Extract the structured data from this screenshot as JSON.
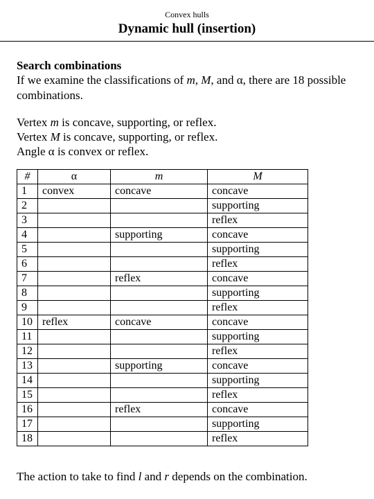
{
  "header": {
    "topic": "Convex hulls",
    "title": "Dynamic hull (insertion)"
  },
  "section": {
    "heading": "Search combinations",
    "p1a": "If we examine the classifications of ",
    "p1_m": "m",
    "p1_comma1": ", ",
    "p1_M": "M",
    "p1_comma2": ", and ",
    "p1_alpha": "α",
    "p1b": ", there are 18 possible combinations.",
    "p2_l1a": "Vertex ",
    "p2_l1m": "m",
    "p2_l1b": " is concave, supporting, or reflex.",
    "p2_l2a": "Vertex ",
    "p2_l2M": "M",
    "p2_l2b": " is concave, supporting, or reflex.",
    "p2_l3a": "Angle ",
    "p2_l3alpha": "α",
    "p2_l3b": " is convex or reflex."
  },
  "table": {
    "head": {
      "c0": "#",
      "c1": "α",
      "c2": "m",
      "c3": "M"
    },
    "rows": [
      {
        "n": "1",
        "a": "convex",
        "m": "concave",
        "M": "concave"
      },
      {
        "n": "2",
        "a": "",
        "m": "",
        "M": "supporting"
      },
      {
        "n": "3",
        "a": "",
        "m": "",
        "M": "reflex"
      },
      {
        "n": "4",
        "a": "",
        "m": "supporting",
        "M": "concave"
      },
      {
        "n": "5",
        "a": "",
        "m": "",
        "M": "supporting"
      },
      {
        "n": "6",
        "a": "",
        "m": "",
        "M": "reflex"
      },
      {
        "n": "7",
        "a": "",
        "m": "reflex",
        "M": "concave"
      },
      {
        "n": "8",
        "a": "",
        "m": "",
        "M": "supporting"
      },
      {
        "n": "9",
        "a": "",
        "m": "",
        "M": "reflex"
      },
      {
        "n": "10",
        "a": "reflex",
        "m": "concave",
        "M": "concave"
      },
      {
        "n": "11",
        "a": "",
        "m": "",
        "M": "supporting"
      },
      {
        "n": "12",
        "a": "",
        "m": "",
        "M": "reflex"
      },
      {
        "n": "13",
        "a": "",
        "m": "supporting",
        "M": "concave"
      },
      {
        "n": "14",
        "a": "",
        "m": "",
        "M": "supporting"
      },
      {
        "n": "15",
        "a": "",
        "m": "",
        "M": "reflex"
      },
      {
        "n": "16",
        "a": "",
        "m": "reflex",
        "M": "concave"
      },
      {
        "n": "17",
        "a": "",
        "m": "",
        "M": "supporting"
      },
      {
        "n": "18",
        "a": "",
        "m": "",
        "M": "reflex"
      }
    ]
  },
  "footer": {
    "a": "The action to take to find ",
    "l": "l",
    "mid": " and ",
    "r": "r",
    "b": " depends on the combination."
  }
}
